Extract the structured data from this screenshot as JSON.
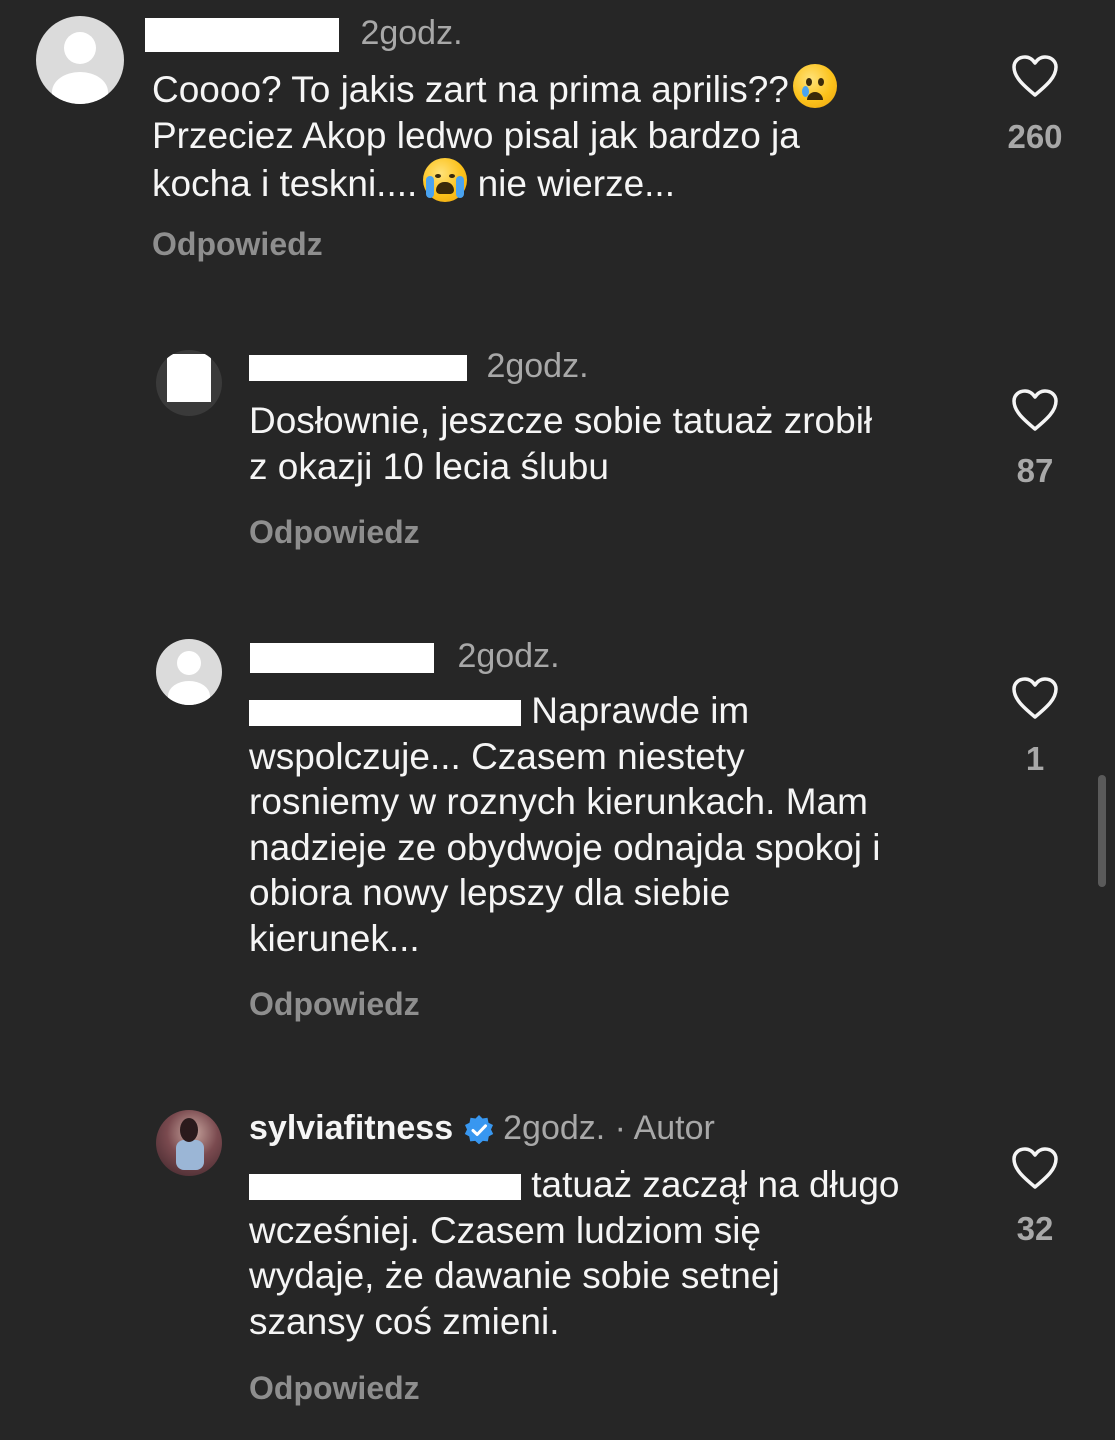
{
  "comments": [
    {
      "time": "2godz.",
      "text_1": "Coooo? To jakis zart na prima aprilis??",
      "text_2": "Przeciez Akop ledwo pisal jak bardzo ja",
      "text_3": "kocha i teskni....",
      "text_4": " nie wierze...",
      "reply_label": "Odpowiedz",
      "like_count": "260"
    },
    {
      "time": "2godz.",
      "text": "Dosłownie, jeszcze sobie tatuaż zrobił\nz okazji 10 lecia ślubu",
      "reply_label": "Odpowiedz",
      "like_count": "87"
    },
    {
      "time": "2godz.",
      "text_first": " Naprawde im",
      "text_rest": "wspolczuje... Czasem niestety\nrosniemy w roznych kierunkach. Mam\nnadzieje ze obydwoje odnajda spokoj i\nobiora nowy lepszy dla siebie\nkierunek...",
      "reply_label": "Odpowiedz",
      "like_count": "1"
    },
    {
      "username": "sylviafitness",
      "time": "2godz.",
      "separator": "·",
      "author_label": "Autor",
      "text_first": " tatuaż zaczął na długo",
      "text_rest": "wcześniej. Czasem ludziom się\nwydaje, że dawanie sobie setnej\nszansy coś zmieni.",
      "reply_label": "Odpowiedz",
      "like_count": "32"
    }
  ],
  "icons": {
    "like": "heart-outline-icon",
    "verified": "verified-badge-icon",
    "emoji_1": "crying-face-emoji",
    "emoji_2": "loudly-crying-face-emoji"
  },
  "colors": {
    "background": "#262626",
    "text": "#f5f5f5",
    "secondary": "#a8a8a8",
    "verified": "#3897f0"
  }
}
